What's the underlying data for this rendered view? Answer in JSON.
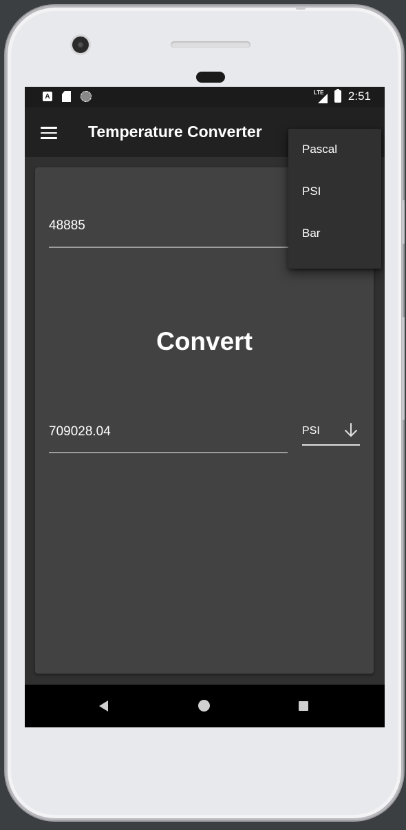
{
  "status_bar": {
    "time": "2:51",
    "network": "LTE",
    "icons": [
      "a-icon",
      "sd-card-icon",
      "sync-icon",
      "lte-signal-icon",
      "battery-icon"
    ]
  },
  "app_bar": {
    "title": "Temperature Converter",
    "menu_icon": "hamburger-menu-icon"
  },
  "converter": {
    "input_value": "48885",
    "convert_label": "Convert",
    "output_value": "709028.04",
    "output_unit": "PSI",
    "output_unit_icon": "arrow-down-icon"
  },
  "dropdown": {
    "items": [
      {
        "label": "Pascal"
      },
      {
        "label": "PSI"
      },
      {
        "label": "Bar"
      }
    ]
  },
  "nav_bar": {
    "icons": [
      "back-icon",
      "home-icon",
      "recents-icon"
    ]
  },
  "colors": {
    "background": "#303030",
    "card": "#424242",
    "app_bar": "#212121",
    "text": "#ffffff"
  }
}
